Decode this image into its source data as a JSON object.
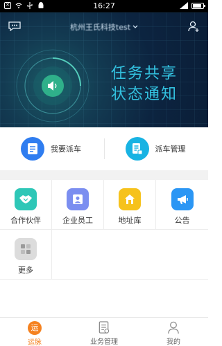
{
  "status_bar": {
    "time": "16:27"
  },
  "header": {
    "title": "杭州王氏科技test"
  },
  "banner": {
    "line1": "任务共享",
    "line2": "状态通知"
  },
  "dispatch": [
    {
      "label": "我要派车",
      "color": "#2f7df0"
    },
    {
      "label": "派车管理",
      "color": "#18b3e3"
    }
  ],
  "apps": [
    {
      "label": "合作伙伴",
      "icon": "handshake-icon",
      "color": "#2ec7b7"
    },
    {
      "label": "企业员工",
      "icon": "employee-icon",
      "color": "#7b8ef0"
    },
    {
      "label": "地址库",
      "icon": "home-icon",
      "color": "#f6c21c"
    },
    {
      "label": "公告",
      "icon": "megaphone-icon",
      "color": "#2b96f4"
    },
    {
      "label": "更多",
      "icon": "more-grid-icon",
      "color": "#dcdcdc"
    }
  ],
  "tabs": [
    {
      "label": "运脉",
      "active": true,
      "badge": "运"
    },
    {
      "label": "业务管理",
      "active": false
    },
    {
      "label": "我的",
      "active": false
    }
  ],
  "accent_color": "#f58220"
}
